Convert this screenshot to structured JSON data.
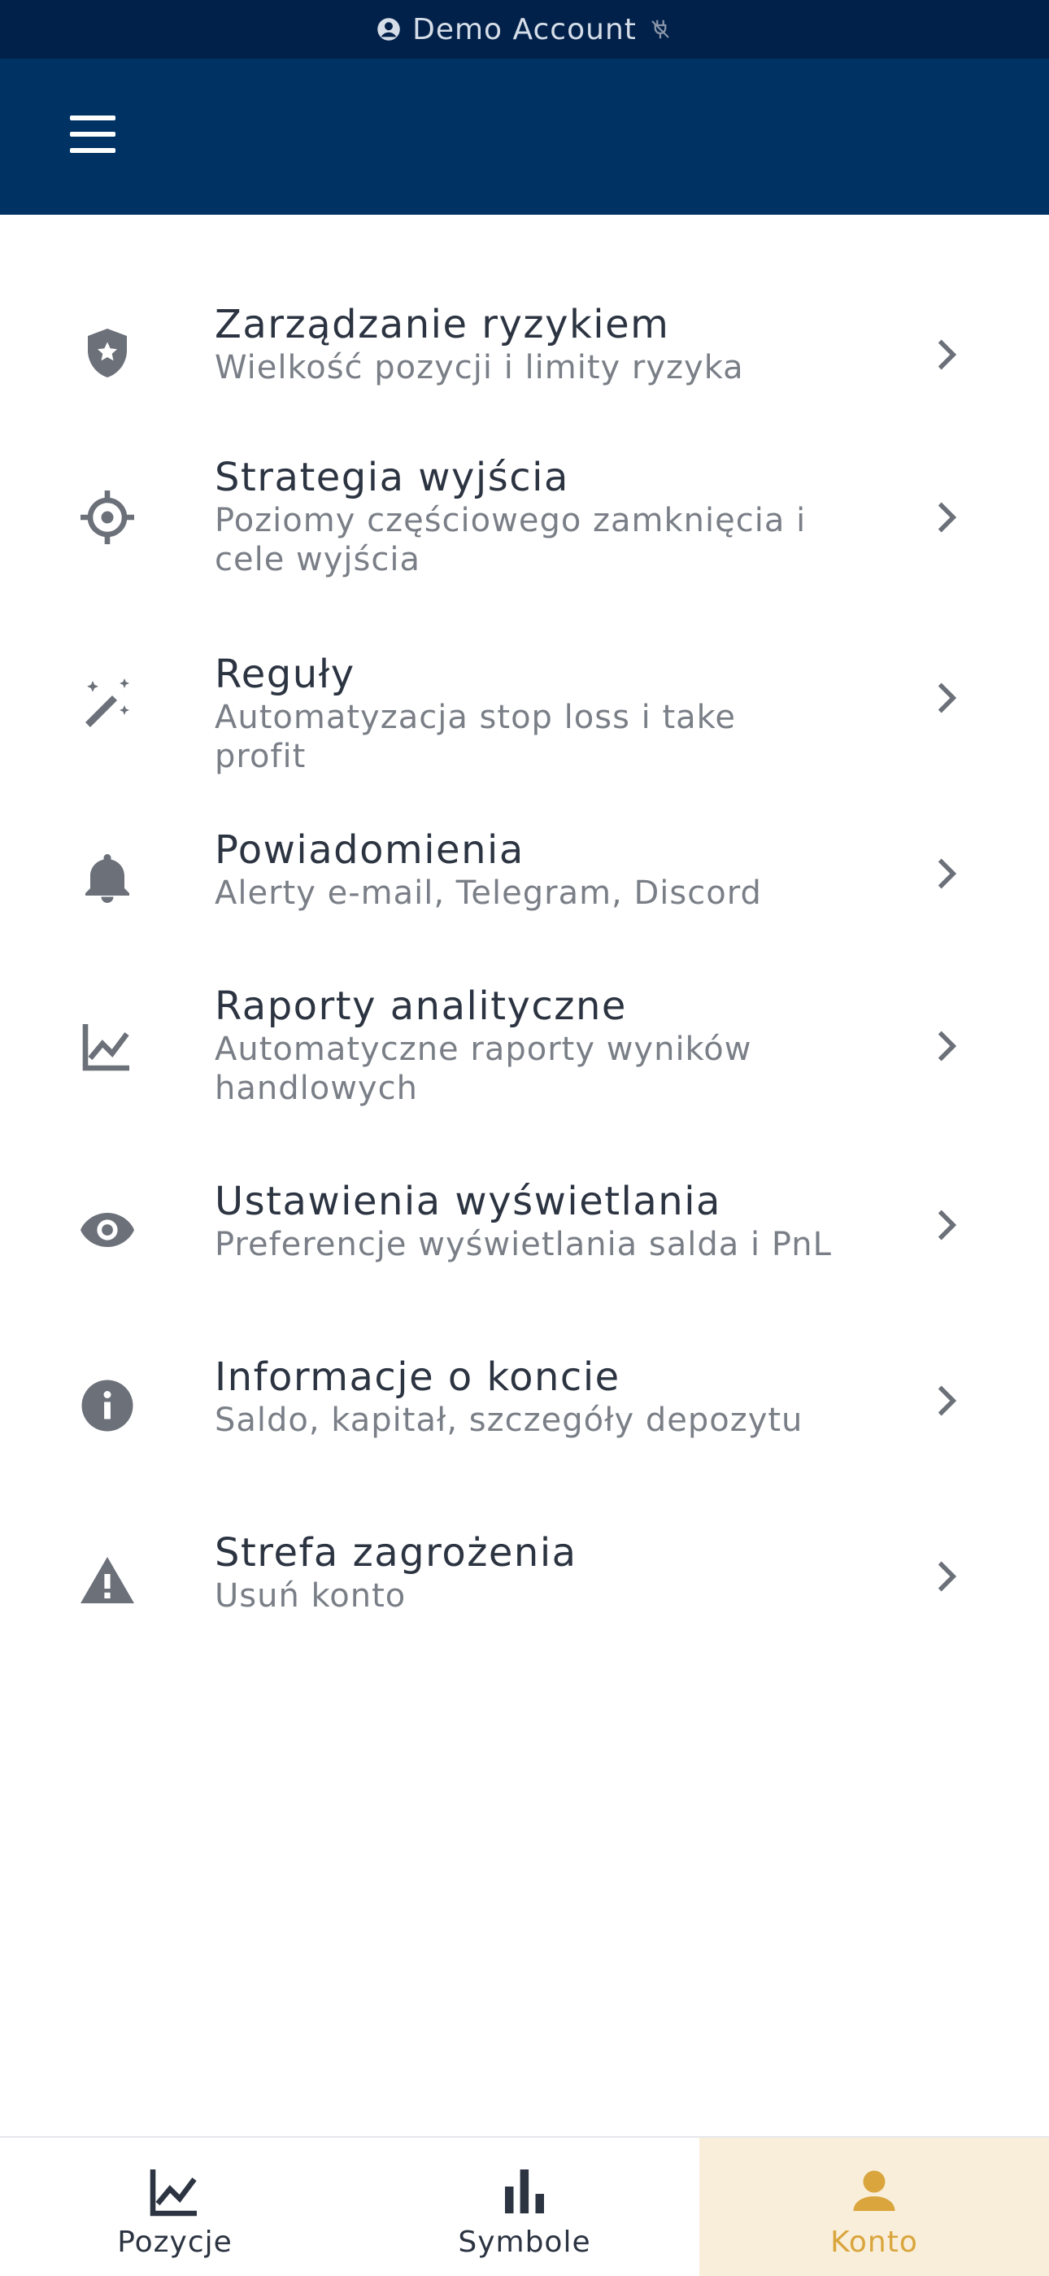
{
  "status_bar": {
    "account_label": "Demo Account",
    "account_icon": "account-circle-icon",
    "connection_icon": "connection-off-icon"
  },
  "app_bar": {
    "menu_icon": "hamburger-menu-icon"
  },
  "menu": [
    {
      "icon": "shield-star-icon",
      "title": "Zarządzanie ryzykiem",
      "subtitle": "Wielkość pozycji i limity ryzyka"
    },
    {
      "icon": "crosshair-icon",
      "title": "Strategia wyjścia",
      "subtitle": "Poziomy częściowego zamknięcia i cele wyjścia"
    },
    {
      "icon": "magic-wand-icon",
      "title": "Reguły",
      "subtitle": "Automatyzacja stop loss i take profit"
    },
    {
      "icon": "bell-icon",
      "title": "Powiadomienia",
      "subtitle": "Alerty e-mail, Telegram, Discord"
    },
    {
      "icon": "line-chart-icon",
      "title": "Raporty analityczne",
      "subtitle": "Automatyczne raporty wyników handlowych"
    },
    {
      "icon": "eye-icon",
      "title": "Ustawienia wyświetlania",
      "subtitle": "Preferencje wyświetlania salda i PnL"
    },
    {
      "icon": "info-icon",
      "title": "Informacje o koncie",
      "subtitle": "Saldo, kapitał, szczegóły depozytu"
    },
    {
      "icon": "warning-icon",
      "title": "Strefa zagrożenia",
      "subtitle": "Usuń konto"
    }
  ],
  "bottom_nav": [
    {
      "icon": "line-chart-icon",
      "label": "Pozycje",
      "active": false
    },
    {
      "icon": "bar-chart-icon",
      "label": "Symbole",
      "active": false
    },
    {
      "icon": "person-icon",
      "label": "Konto",
      "active": true
    }
  ],
  "colors": {
    "header": "#003264",
    "status_bar": "#02214a",
    "accent": "#d9a53c",
    "active_tab_bg": "#f9eed9",
    "icon": "#6b7079"
  }
}
